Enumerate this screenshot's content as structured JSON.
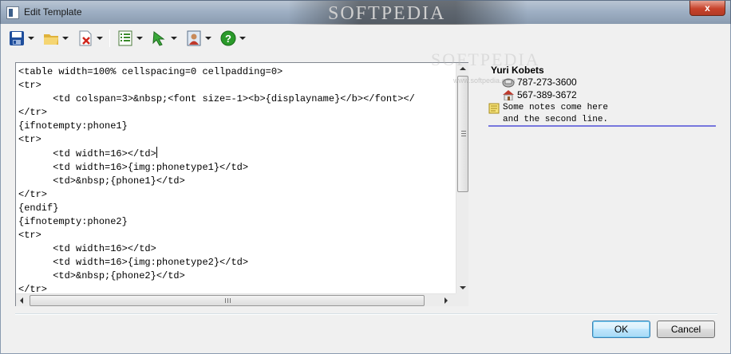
{
  "window": {
    "title": "Edit Template",
    "close_glyph": "x",
    "watermark": "SOFTPEDIA"
  },
  "toolbar": {
    "buttons": [
      {
        "name": "save-icon",
        "has_dropdown": true
      },
      {
        "name": "open-folder-icon",
        "has_dropdown": true
      },
      {
        "name": "delete-document-icon",
        "has_dropdown": true
      },
      {
        "name": "list-icon",
        "has_dropdown": true
      },
      {
        "name": "pointer-arrow-icon",
        "has_dropdown": true
      },
      {
        "name": "contact-card-icon",
        "has_dropdown": true
      },
      {
        "name": "help-icon",
        "has_dropdown": true
      }
    ]
  },
  "editor": {
    "lines": [
      "<table width=100% cellspacing=0 cellpadding=0>",
      "<tr>",
      "      <td colspan=3>&nbsp;<font size=-1><b>{displayname}</b></font></",
      "</tr>",
      "{ifnotempty:phone1}",
      "<tr>",
      "      <td width=16></td>",
      "      <td width=16>{img:phonetype1}</td>",
      "      <td>&nbsp;{phone1}</td>",
      "</tr>",
      "{endif}",
      "{ifnotempty:phone2}",
      "<tr>",
      "      <td width=16></td>",
      "      <td width=16>{img:phonetype2}</td>",
      "      <td>&nbsp;{phone2}</td>",
      "</tr>"
    ],
    "cursor_line": 6
  },
  "preview": {
    "name": "Yuri Kobets",
    "phone1": "787-273-3600",
    "phone2": "567-389-3672",
    "notes": "Some notes come here\nand the second line.",
    "watermark": "SOFTPEDIA",
    "watermark_url": "www.softpedia.com"
  },
  "buttons": {
    "ok": "OK",
    "cancel": "Cancel"
  },
  "colors": {
    "separator_line": "#7777dd",
    "title_close": "#c7432b",
    "save_blue": "#1f4e9c",
    "help_green": "#2a9a2a"
  }
}
